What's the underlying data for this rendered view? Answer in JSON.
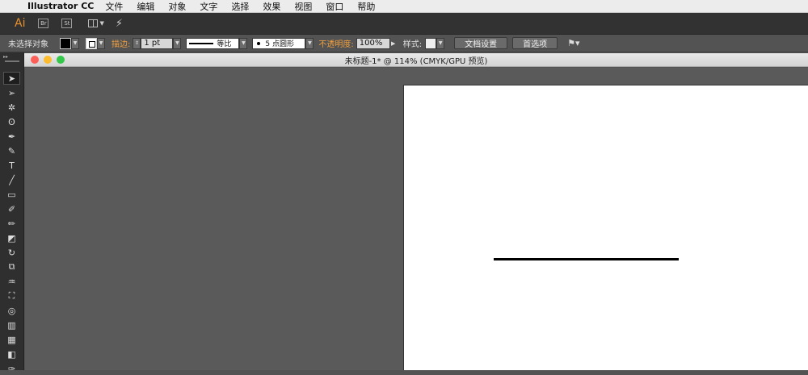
{
  "menubar": {
    "app_name": "Illustrator CC",
    "items": [
      "文件",
      "编辑",
      "对象",
      "文字",
      "选择",
      "效果",
      "视图",
      "窗口",
      "帮助"
    ]
  },
  "appbar": {
    "logo": "Ai",
    "bridge": "Br",
    "stock": "St"
  },
  "controlbar": {
    "selection_status": "未选择对象",
    "stroke_label": "描边:",
    "stroke_weight": "1 pt",
    "profile_label": "等比",
    "brush_label": "5 点圆形",
    "opacity_label": "不透明度:",
    "opacity_value": "100%",
    "style_label": "样式:",
    "doc_setup_button": "文档设置",
    "prefs_button": "首选项"
  },
  "document": {
    "title": "未标题-1* @ 114% (CMYK/GPU 预览)"
  },
  "tools": [
    "selection-tool",
    "direct-selection-tool",
    "magic-wand-tool",
    "lasso-tool",
    "pen-tool",
    "curvature-tool",
    "type-tool",
    "line-segment-tool",
    "rectangle-tool",
    "paintbrush-tool",
    "pencil-tool",
    "eraser-tool",
    "rotate-tool",
    "scale-tool",
    "warp-tool",
    "free-transform-tool",
    "shape-builder-tool",
    "perspective-grid-tool",
    "mesh-tool",
    "gradient-tool",
    "eyedropper-tool"
  ],
  "colors": {
    "accent": "#e8902d",
    "ui_dark": "#323232",
    "canvas_bg": "#5a5a5a",
    "artboard": "#ffffff"
  }
}
